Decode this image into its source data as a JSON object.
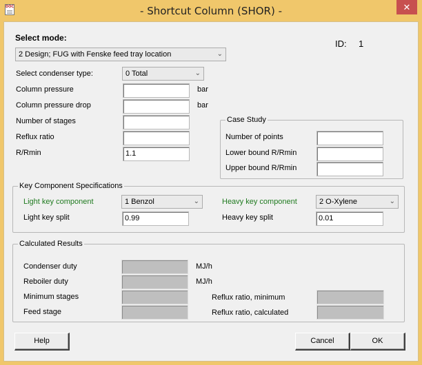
{
  "window": {
    "title": "- Shortcut Column (SHOR) -",
    "icon": "doc-icon",
    "icon_text": "DOC",
    "close_glyph": "✕"
  },
  "mode": {
    "label": "Select mode:",
    "selected": "2 Design; FUG with Fenske feed tray location"
  },
  "id": {
    "label": "ID:",
    "value": "1"
  },
  "condenser": {
    "label": "Select condenser type:",
    "selected": "0 Total"
  },
  "fields": {
    "column_pressure": {
      "label": "Column pressure",
      "value": "",
      "unit": "bar"
    },
    "column_pressure_drop": {
      "label": "Column pressure drop",
      "value": "",
      "unit": "bar"
    },
    "number_of_stages": {
      "label": "Number of stages",
      "value": ""
    },
    "reflux_ratio": {
      "label": "Reflux ratio",
      "value": ""
    },
    "r_rmin": {
      "label": "R/Rmin",
      "value": "1.1"
    }
  },
  "case_study": {
    "title": "Case Study",
    "number_of_points": {
      "label": "Number of points",
      "value": ""
    },
    "lower_bound": {
      "label": "Lower bound R/Rmin",
      "value": ""
    },
    "upper_bound": {
      "label": "Upper bound R/Rmin",
      "value": ""
    }
  },
  "key_components": {
    "title": "Key Component Specifications",
    "light_key": {
      "label": "Light key component",
      "selected": "1 Benzol"
    },
    "light_split": {
      "label": "Light key split",
      "value": "0.99"
    },
    "heavy_key": {
      "label": "Heavy key component",
      "selected": "2 O-Xylene"
    },
    "heavy_split": {
      "label": "Heavy key split",
      "value": "0.01"
    },
    "label_color": "#1f7a1f"
  },
  "results": {
    "title": "Calculated Results",
    "condenser_duty": {
      "label": "Condenser duty",
      "value": "",
      "unit": "MJ/h"
    },
    "reboiler_duty": {
      "label": "Reboiler duty",
      "value": "",
      "unit": "MJ/h"
    },
    "minimum_stages": {
      "label": "Minimum stages",
      "value": ""
    },
    "feed_stage": {
      "label": "Feed stage",
      "value": ""
    },
    "reflux_min": {
      "label": "Reflux ratio, minimum",
      "value": ""
    },
    "reflux_calc": {
      "label": "Reflux ratio, calculated",
      "value": ""
    }
  },
  "buttons": {
    "help": "Help",
    "cancel": "Cancel",
    "ok": "OK"
  },
  "colors": {
    "titlebar": "#f0c76b",
    "close": "#c7504f",
    "dialog_bg": "#f0f0f0",
    "readonly_field": "#bfbfbf"
  }
}
